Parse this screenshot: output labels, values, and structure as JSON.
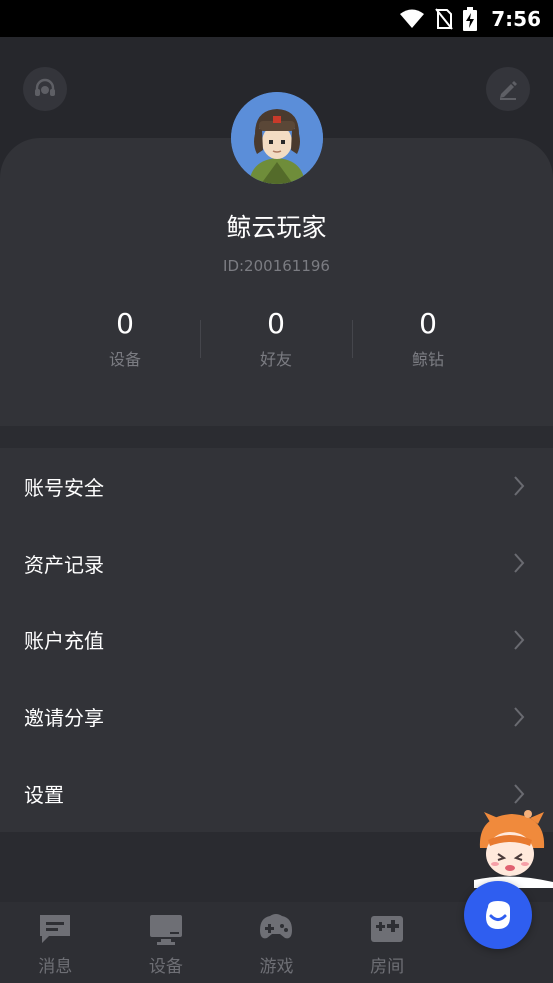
{
  "status_bar": {
    "time": "7:56"
  },
  "profile": {
    "nickname": "鲸云玩家",
    "user_id": "ID:200161196",
    "stats": [
      {
        "value": "0",
        "label": "设备"
      },
      {
        "value": "0",
        "label": "好友"
      },
      {
        "value": "0",
        "label": "鲸钻"
      }
    ]
  },
  "menu": {
    "items": [
      {
        "label": "账号安全"
      },
      {
        "label": "资产记录"
      },
      {
        "label": "账户充值"
      },
      {
        "label": "邀请分享"
      },
      {
        "label": "设置"
      }
    ]
  },
  "tabs": [
    {
      "label": "消息",
      "icon": "message-icon"
    },
    {
      "label": "设备",
      "icon": "monitor-icon"
    },
    {
      "label": "游戏",
      "icon": "gamepad-icon"
    },
    {
      "label": "房间",
      "icon": "room-icon"
    }
  ],
  "colors": {
    "background": "#26272c",
    "card": "#323338",
    "accent": "#2f5ef0",
    "avatar_bg": "#5b8ed9",
    "muted_text": "#7b7c82"
  }
}
